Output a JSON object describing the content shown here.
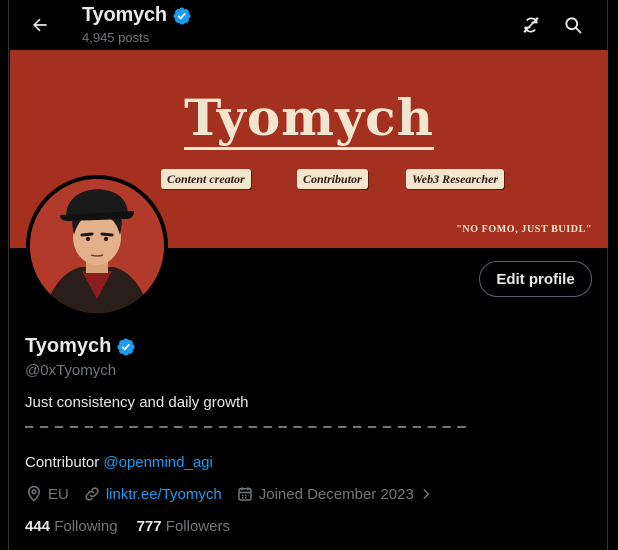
{
  "header": {
    "name": "Tyomych",
    "posts": "4,945 posts"
  },
  "banner": {
    "title": "Tyomych",
    "pills": [
      "Content creator",
      "Contributor",
      "Web3 Researcher"
    ],
    "quote": "\"NO FOMO, JUST BUIDL\""
  },
  "actions": {
    "edit_profile": "Edit profile"
  },
  "profile": {
    "name": "Tyomych",
    "handle": "@0xTyomych",
    "bio_line1": "Just consistency and daily growth",
    "bio_line2": "– – – – – – – – – – – – – – – – – – – – – – – – – – – – – –",
    "bio_line3_prefix": "Contributor ",
    "bio_line3_mention": "@openmind_agi",
    "location": "EU",
    "website": "linktr.ee/Tyomych",
    "joined": "Joined December 2023",
    "following_count": "444",
    "following_label": "Following",
    "followers_count": "777",
    "followers_label": "Followers"
  },
  "colors": {
    "accent": "#1d9bf0",
    "banner_bg": "#a4311f",
    "banner_text": "#f3e6cf",
    "muted": "#71767b"
  },
  "icons": {
    "back": "arrow-left-icon",
    "sync": "sync-off-icon",
    "search": "search-icon",
    "verified": "verified-badge-icon",
    "location": "location-pin-icon",
    "link": "link-icon",
    "calendar": "calendar-icon",
    "chevron": "chevron-right-icon"
  }
}
